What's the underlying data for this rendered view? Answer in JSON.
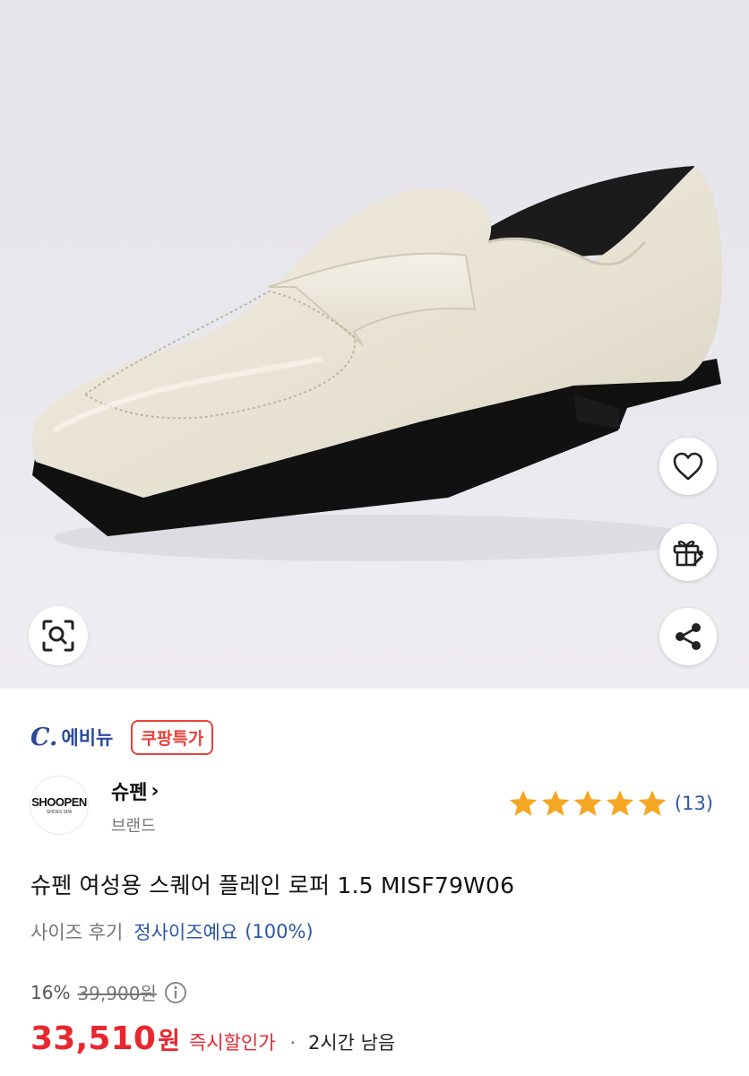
{
  "vendor": {
    "logo_text": "C.",
    "name": "에비뉴",
    "badge": "쿠팡특가"
  },
  "brand": {
    "logo_line1": "SHOOPEN",
    "logo_line2": "SHOES SPA",
    "name": "슈펜",
    "chevron": "›",
    "label": "브랜드"
  },
  "rating": {
    "stars": 5,
    "count_text": "(13)"
  },
  "product": {
    "title": "슈펜 여성용 스퀘어 플레인 로퍼 1.5 MISF79W06"
  },
  "size_review": {
    "label": "사이즈 후기",
    "value": "정사이즈예요",
    "percent": "(100%)"
  },
  "pricing": {
    "discount_rate": "16%",
    "original_price": "39,900원",
    "price": "33,510",
    "unit": "원",
    "tag": "즉시할인가",
    "separator": "·",
    "remaining": "2시간 남음"
  },
  "icons": {
    "wishlist": "heart-icon",
    "gift": "gift-icon",
    "share": "share-icon",
    "image_search": "image-search-icon",
    "info": "info-icon"
  },
  "colors": {
    "price": "#e8272f",
    "link": "#2a57a8",
    "star": "#f6a623",
    "vendor": "#2a4a9b"
  }
}
